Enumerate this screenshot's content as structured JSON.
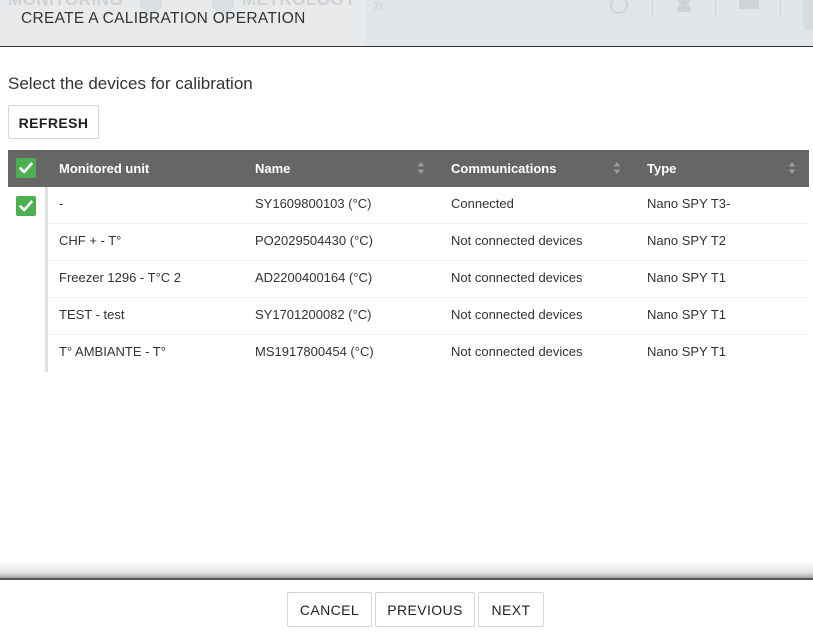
{
  "background": {
    "nav_left": "MONITORING",
    "nav_right": "METROLOGY"
  },
  "modal": {
    "title": "CREATE A CALIBRATION OPERATION",
    "subtitle": "Select the devices for calibration",
    "refresh_label": "REFRESH"
  },
  "table": {
    "headers": [
      "Monitored unit",
      "Name",
      "Communications",
      "Type"
    ],
    "rows": [
      {
        "unit": "-",
        "name": "SY1609800103 (°C)",
        "comm": "Connected",
        "type": "Nano SPY T3-",
        "checked": true
      },
      {
        "unit": "CHF + - T°",
        "name": "PO2029504430 (°C)",
        "comm": "Not connected devices",
        "type": "Nano SPY T2",
        "checked": false
      },
      {
        "unit": "Freezer 1296 - T°C 2",
        "name": "AD2200400164 (°C)",
        "comm": "Not connected devices",
        "type": "Nano SPY T1",
        "checked": false
      },
      {
        "unit": "TEST - test",
        "name": "SY1701200082 (°C)",
        "comm": "Not connected devices",
        "type": "Nano SPY T1",
        "checked": false
      },
      {
        "unit": "T° AMBIANTE - T°",
        "name": "MS1917800454 (°C)",
        "comm": "Not connected devices",
        "type": "Nano SPY T1",
        "checked": false
      }
    ],
    "select_all_checked": true
  },
  "footer": {
    "cancel_label": "CANCEL",
    "previous_label": "PREVIOUS",
    "next_label": "NEXT"
  },
  "colors": {
    "header_bg": "#666666",
    "check_green": "#4caf50"
  },
  "icons": {
    "checkbox": "check-icon",
    "sort": "sort-arrows-icon",
    "nav_chevron": "double-chevron-right-icon"
  }
}
